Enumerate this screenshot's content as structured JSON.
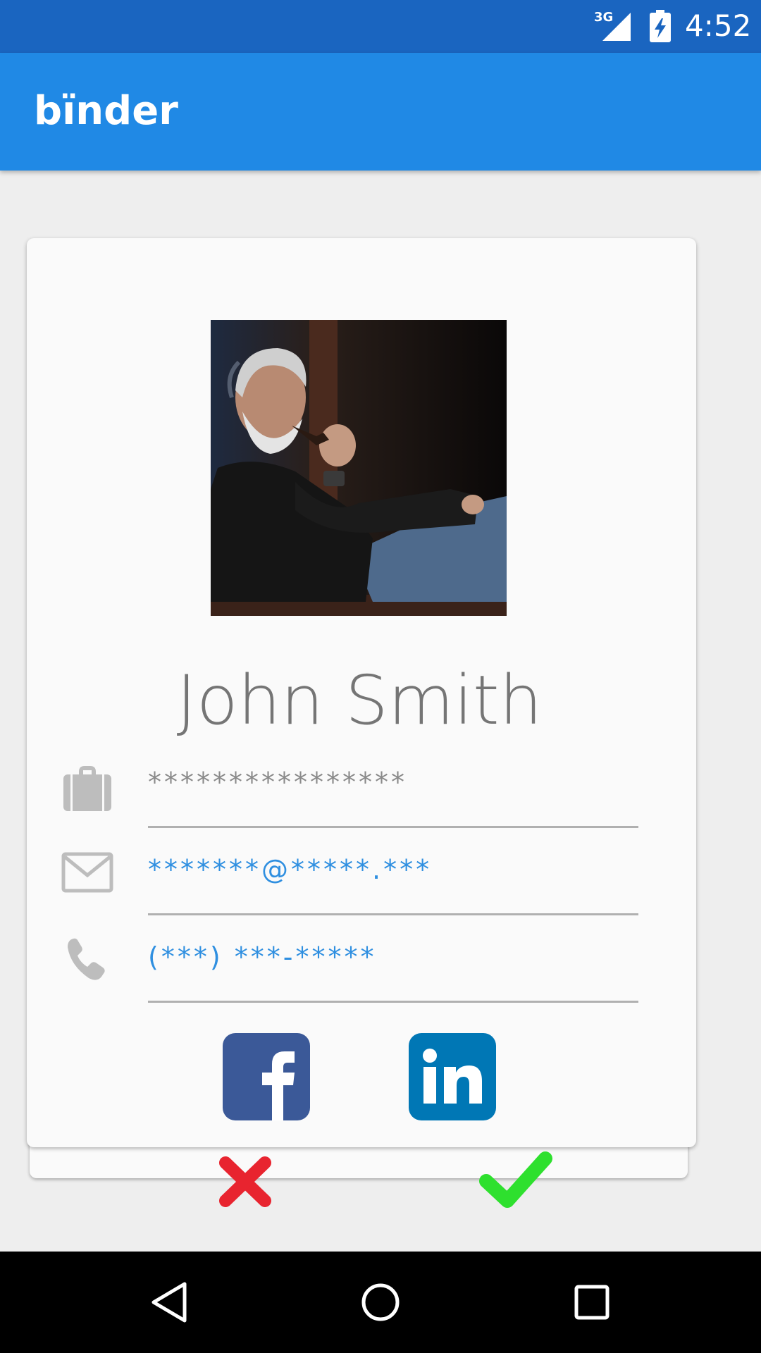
{
  "status_bar": {
    "network_label": "3G",
    "time": "4:52",
    "network_icon": "signal-icon",
    "battery_icon": "battery-charging-icon"
  },
  "app_bar": {
    "title": "bïnder"
  },
  "profile": {
    "photo_icon": "profile-photo",
    "name": "John Smith",
    "fields": [
      {
        "icon": "briefcase-icon",
        "value": "****************"
      },
      {
        "icon": "mail-icon",
        "value": "*******@*****.***"
      },
      {
        "icon": "phone-icon",
        "value": "(***) ***-*****"
      }
    ],
    "social": [
      {
        "icon": "facebook-icon"
      },
      {
        "icon": "linkedin-icon"
      }
    ]
  },
  "actions": {
    "reject_icon": "close-icon",
    "accept_icon": "check-icon"
  },
  "nav_bar": {
    "back_icon": "back-icon",
    "home_icon": "home-icon",
    "recents_icon": "recents-icon"
  },
  "colors": {
    "status_bar": "#1a65c0",
    "app_bar": "#2089e5",
    "background": "#eeeeee",
    "card": "#fafafa",
    "name_text": "#757575",
    "field_grey": "#8a8a8a",
    "field_blue": "#2f8fe0",
    "facebook": "#3b5998",
    "linkedin": "#0077b5",
    "reject": "#e8242f",
    "accept": "#2ee02e"
  }
}
